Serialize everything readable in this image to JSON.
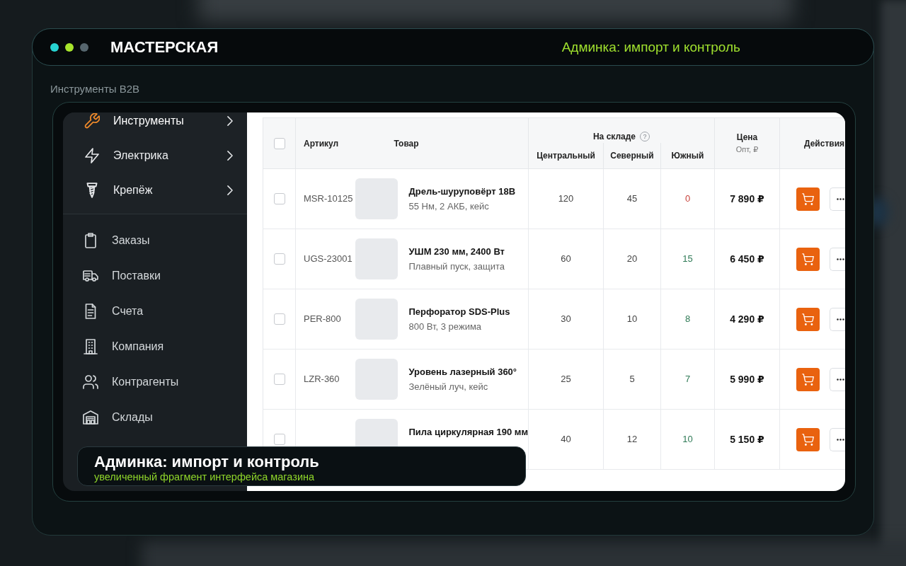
{
  "window": {
    "title": "МАСТЕРСКАЯ",
    "subtitle": "Админка: импорт и контроль"
  },
  "section_label": "Инструменты B2B",
  "sidebar": {
    "categories": [
      {
        "label": "Инструменты",
        "selected": true
      },
      {
        "label": "Электрика",
        "selected": false
      },
      {
        "label": "Крепёж",
        "selected": false
      }
    ],
    "items": [
      {
        "label": "Заказы",
        "selected": false
      },
      {
        "label": "Поставки",
        "selected": false
      },
      {
        "label": "Счета",
        "selected": false
      },
      {
        "label": "Компания",
        "selected": false
      },
      {
        "label": "Контрагенты",
        "selected": false
      },
      {
        "label": "Склады",
        "selected": false
      }
    ]
  },
  "table": {
    "select_all": {
      "checked": false
    },
    "columns": {
      "sku": "Артикул",
      "product": "Товар",
      "stock_group": "На складе",
      "stock_help": "?",
      "central": "Центральный",
      "north": "Северный",
      "south": "Южный",
      "price": "Цена",
      "price_note": "Опт, ₽",
      "actions": "Действия"
    },
    "rows": [
      {
        "checked": false,
        "sku": "MSR-10125",
        "name": "Дрель-шуруповёрт 18В",
        "details": "55 Нм, 2 АКБ, кейс",
        "central": "120",
        "north": "45",
        "south": "0",
        "south_empty": true,
        "price": "7 890 ₽"
      },
      {
        "checked": false,
        "sku": "UGS-23001",
        "name": "УШМ 230 мм, 2400 Вт",
        "details": "Плавный пуск, защита",
        "central": "60",
        "north": "20",
        "south": "15",
        "south_empty": false,
        "price": "6 450 ₽"
      },
      {
        "checked": false,
        "sku": "PER-800",
        "name": "Перфоратор SDS-Plus",
        "details": "800 Вт, 3 режима",
        "central": "30",
        "north": "10",
        "south": "8",
        "south_empty": false,
        "price": "4 290 ₽"
      },
      {
        "checked": false,
        "sku": "LZR-360",
        "name": "Уровень лазерный 360°",
        "details": "Зелёный луч, кейс",
        "central": "25",
        "north": "5",
        "south": "7",
        "south_empty": false,
        "price": "5 990 ₽"
      },
      {
        "checked": false,
        "name": "Пила циркулярная 190 мм",
        "central": "40",
        "north": "12",
        "south": "10",
        "south_empty": false,
        "price": "5 150 ₽"
      }
    ]
  },
  "caption": {
    "title": "Админка: импорт и контроль",
    "subtitle": "увеличенный фрагмент интерфейса магазина"
  }
}
